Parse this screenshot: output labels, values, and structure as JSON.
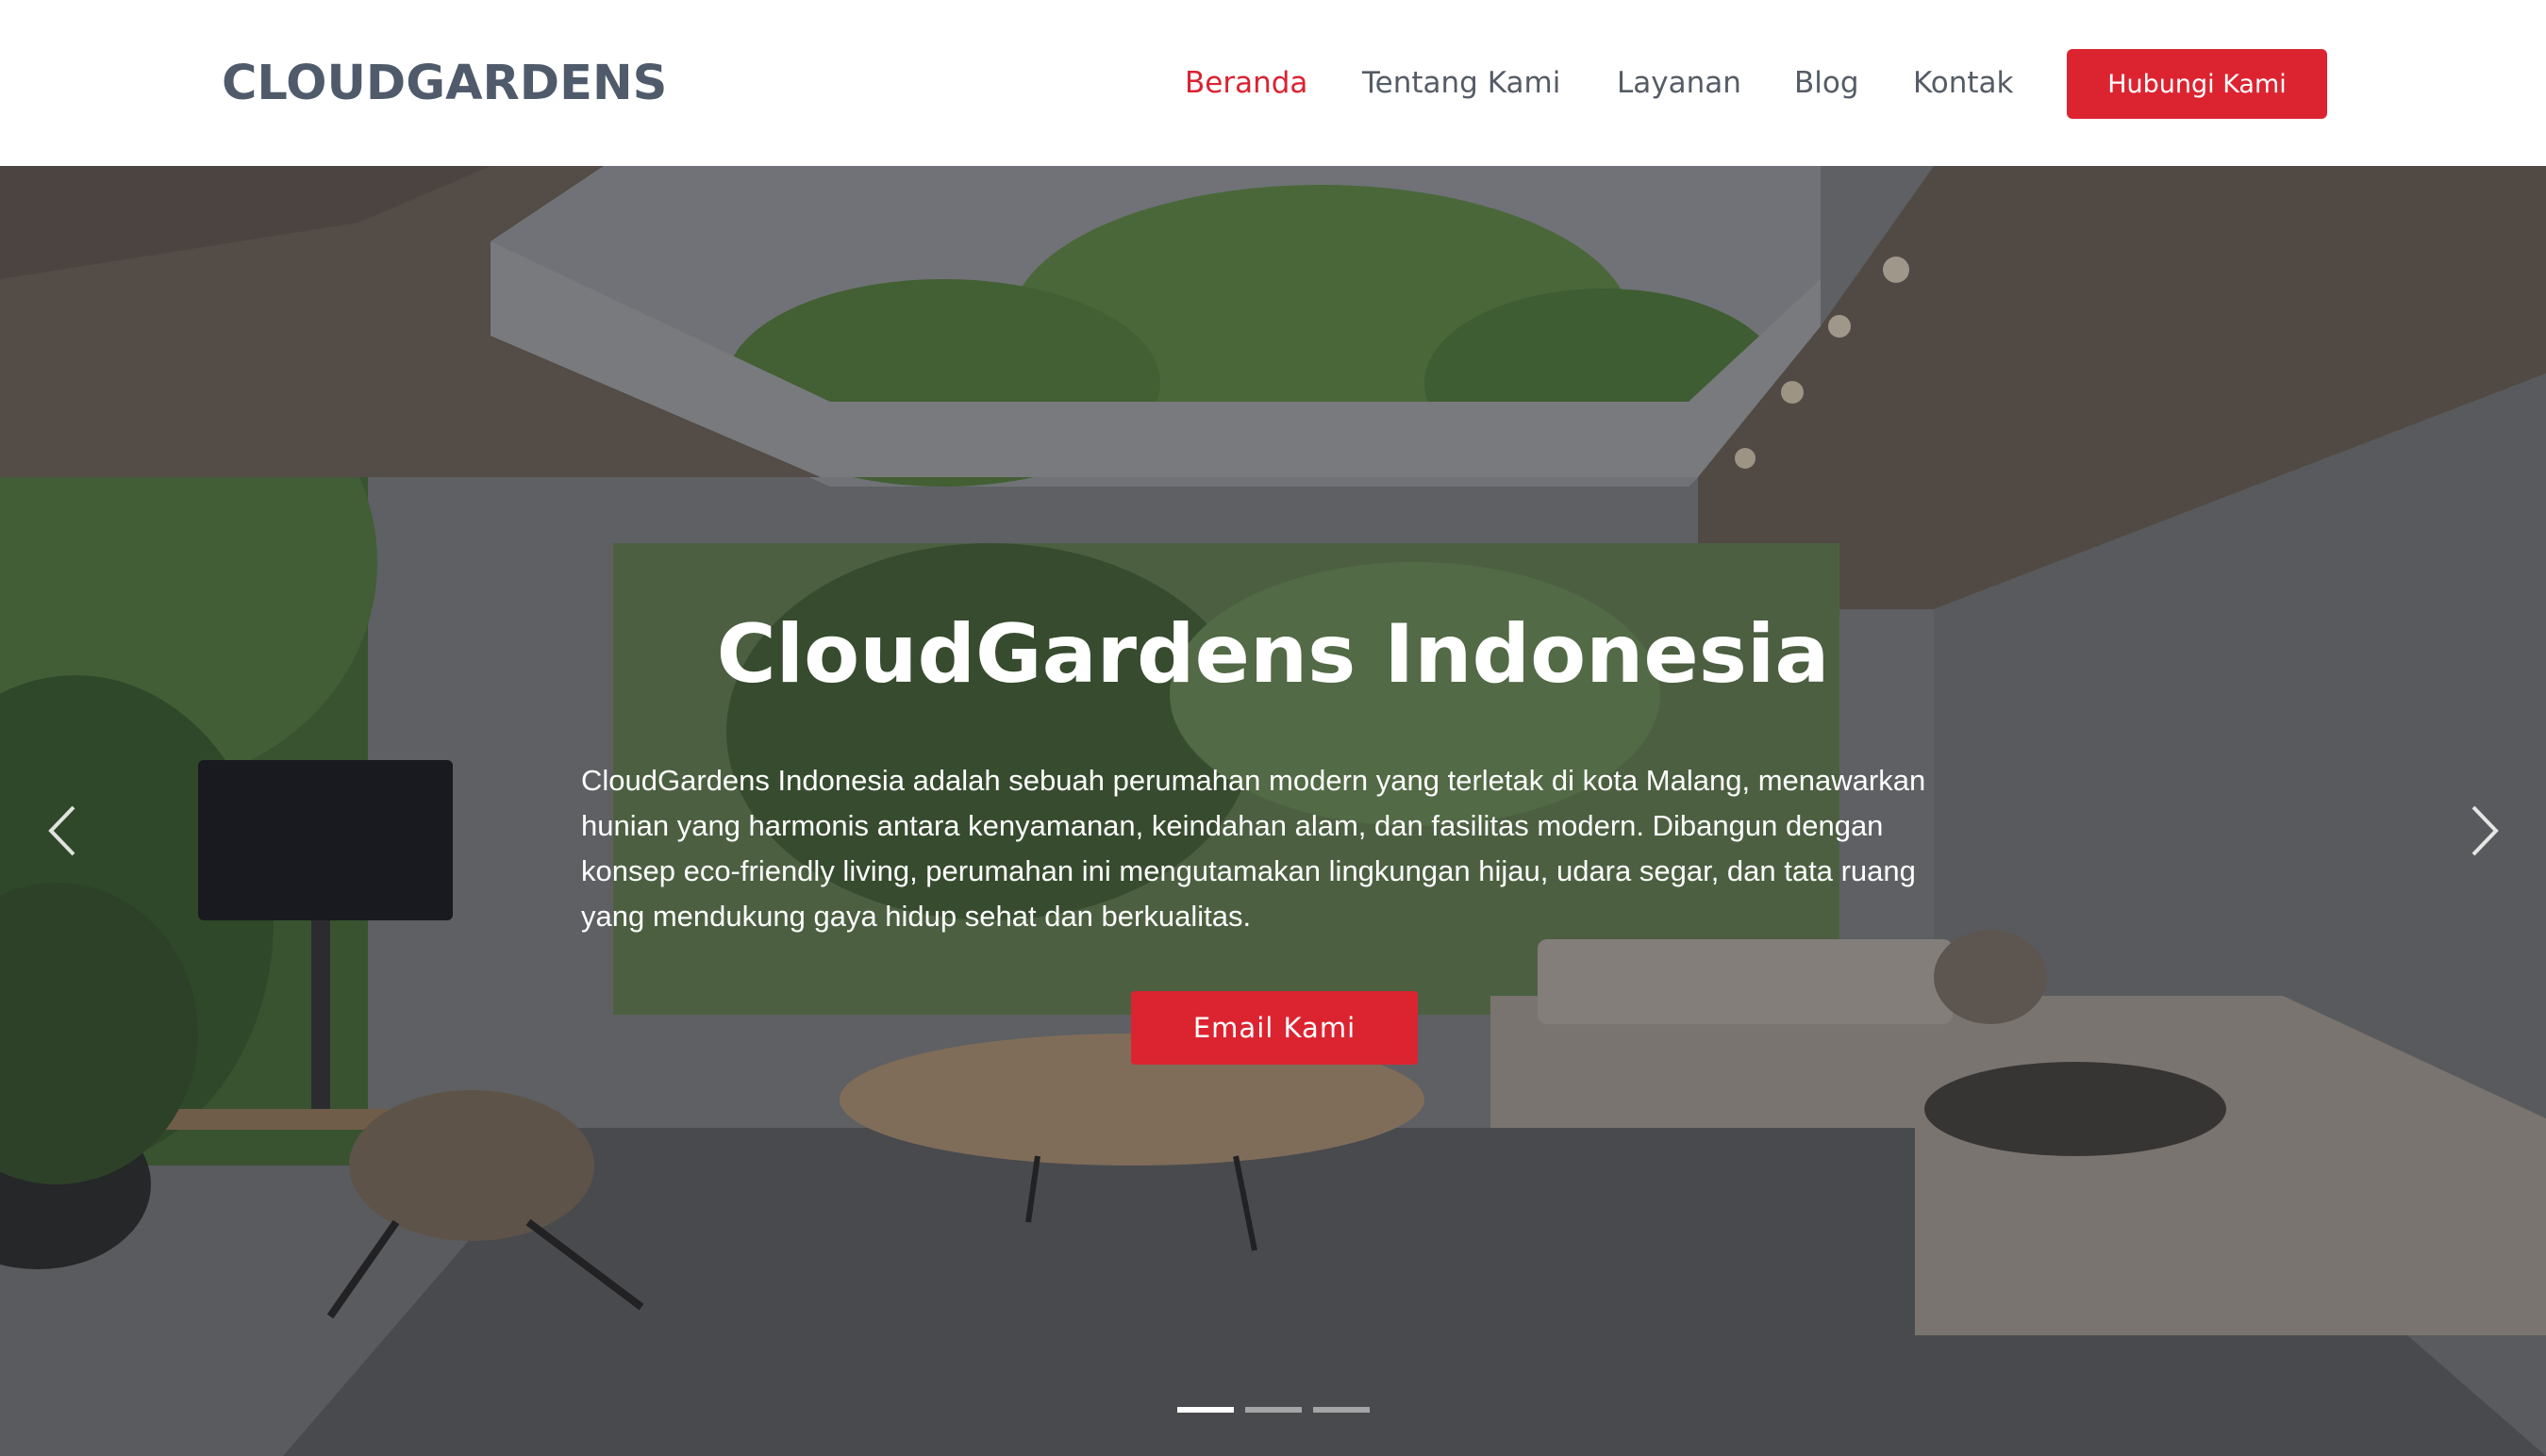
{
  "header": {
    "logo": "CLOUDGARDENS",
    "nav": {
      "home": "Beranda",
      "about": "Tentang Kami",
      "services": "Layanan",
      "blog": "Blog",
      "contact": "Kontak"
    },
    "cta_label": "Hubungi Kami"
  },
  "hero": {
    "title": "CloudGardens Indonesia",
    "description": "CloudGardens Indonesia adalah sebuah perumahan modern yang terletak di kota Malang, menawarkan hunian yang harmonis antara kenyamanan, keindahan alam, dan fasilitas modern. Dibangun dengan konsep eco-friendly living, perumahan ini mengutamakan lingkungan hijau, udara segar, dan tata ruang yang mendukung gaya hidup sehat dan berkualitas.",
    "button_label": "Email Kami",
    "slide_count": 3,
    "active_slide": 1
  },
  "icons": {
    "prev": "chevron-left-icon",
    "next": "chevron-right-icon"
  },
  "colors": {
    "accent": "#dc2431",
    "logo": "#4f5b6b",
    "nav_text": "#555c66",
    "nav_active": "#d92332"
  }
}
